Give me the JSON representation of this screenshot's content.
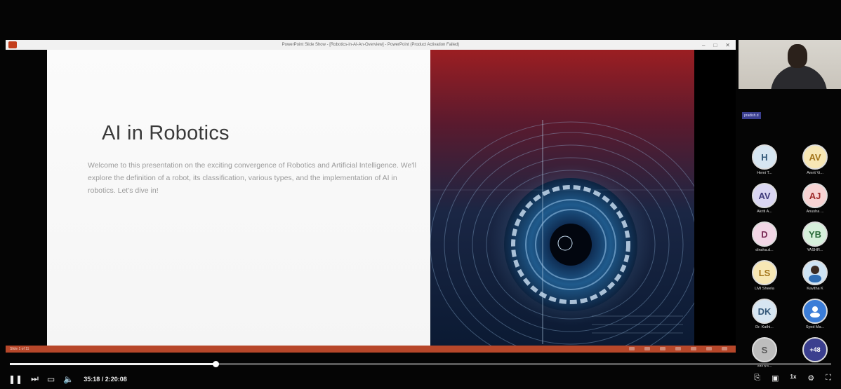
{
  "ppt_window": {
    "title": "PowerPoint Slide Show - [Robotics-in-AI-An-Overview] - PowerPoint (Product Activation Failed)",
    "controls": [
      "–",
      "□",
      "✕"
    ]
  },
  "slide": {
    "title": "AI in Robotics",
    "body": "Welcome to this presentation on the exciting convergence of Robotics and Artificial Intelligence. We'll explore the definition of a robot, its classification, various types, and the implementation of AI in robotics. Let's dive in!"
  },
  "status_bar": {
    "slide_counter": "Slide 1 of 11"
  },
  "meeting": {
    "presenter_name": "pradish.d",
    "participants": [
      {
        "initials": "H",
        "name": "Hemi T...",
        "bg": "#d7e6f2",
        "fg": "#34597a"
      },
      {
        "initials": "AV",
        "name": "Amrit Vi...",
        "bg": "#f7e7b5",
        "fg": "#a3751b"
      },
      {
        "initials": "AV",
        "name": "Akriti A...",
        "bg": "#dad6f2",
        "fg": "#3f3a7a"
      },
      {
        "initials": "AJ",
        "name": "Anusha ...",
        "bg": "#f7d3d3",
        "fg": "#9e2b2b"
      },
      {
        "initials": "D",
        "name": "dinsha.d...",
        "bg": "#f2d7e6",
        "fg": "#7a2b56"
      },
      {
        "initials": "YB",
        "name": "YASHR...",
        "bg": "#d7f0dc",
        "fg": "#2b6b3a"
      },
      {
        "initials": "LS",
        "name": "LMI Sheela",
        "bg": "#f7e7b5",
        "fg": "#a3751b"
      },
      {
        "initials": "",
        "name": "Kavitha K",
        "bg": "#cfe4f4",
        "fg": "#34597a"
      },
      {
        "initials": "DK",
        "name": "Dr. Kathi...",
        "bg": "#d7e6f2",
        "fg": "#34597a"
      },
      {
        "initials": "",
        "name": "Syed Ma...",
        "bg": "#3b7dd8",
        "fg": "#ffffff"
      },
      {
        "initials": "S",
        "name": "sathya...",
        "bg": "#bdbdbd",
        "fg": "#555555"
      },
      {
        "initials": "+48",
        "name": "",
        "bg": "#3b3f8f",
        "fg": "#ffffff"
      }
    ]
  },
  "player": {
    "current_time": "35:18 / 2:20:08",
    "progress": 0.25,
    "speed_label": "1x",
    "controls": [
      "play-pause",
      "next",
      "captions",
      "volume"
    ]
  }
}
